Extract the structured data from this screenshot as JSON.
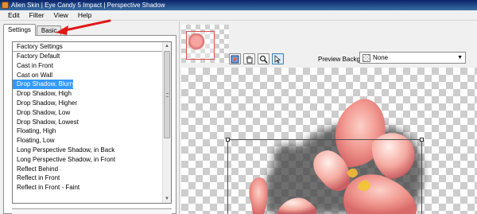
{
  "window": {
    "title": "Alien Skin | Eye Candy 5 Impact | Perspective Shadow"
  },
  "menu": [
    "Edit",
    "Filter",
    "View",
    "Help"
  ],
  "tabs": [
    {
      "label": "Settings",
      "active": true
    },
    {
      "label": "Basic",
      "active": false
    }
  ],
  "settings_list": {
    "header": "Factory Settings",
    "items": [
      "Factory Default",
      "Cast in Front",
      "Cast on Wall",
      "Drop Shadow, Blurry",
      "Drop Shadow, High",
      "Drop Shadow, Higher",
      "Drop Shadow, Low",
      "Drop Shadow, Lowest",
      "Floating, High",
      "Floating, Low",
      "Long Perspective Shadow, in Back",
      "Long Perspective Shadow, in Front",
      "Reflect Behind",
      "Reflect in Front",
      "Reflect in Front - Faint"
    ],
    "selected": "Drop Shadow, Blurry"
  },
  "preview": {
    "background_label": "Preview Background:",
    "background_value": "None"
  },
  "colors": {
    "selection": "#3399ff",
    "annotation_arrow": "#e01818",
    "thumbnail_frame": "#e05050"
  },
  "icons": [
    "app-icon",
    "hand-icon",
    "zoom-icon",
    "pointer-icon",
    "preview-toggle-icon",
    "chevron-down-icon",
    "scroll-up-icon",
    "scroll-down-icon"
  ]
}
